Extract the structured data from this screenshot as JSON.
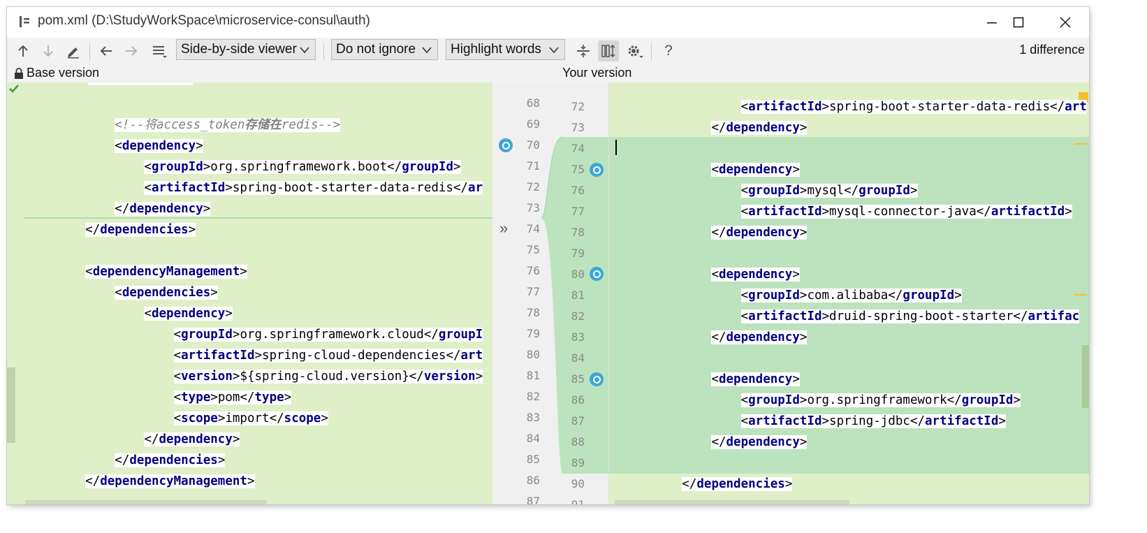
{
  "window": {
    "title": "pom.xml (D:\\StudyWorkSpace\\microservice-consul\\auth)"
  },
  "toolbar": {
    "viewer_mode": "Side-by-side viewer",
    "ignore_mode": "Do not ignore",
    "highlight_mode": "Highlight words",
    "help_label": "?",
    "diff_count": "1 difference"
  },
  "panels": {
    "base_label": "Base version",
    "yours_label": "Your version"
  },
  "colors": {
    "base_bg": "#dff0c8",
    "inserted_bg": "#bce3bd",
    "tag": "#000080",
    "comment": "#808080"
  },
  "left_lines": [
    {
      "num": "68",
      "text": ""
    },
    {
      "num": "69",
      "indent": 4,
      "parts": [
        [
          "cmt",
          "<!--将access_token"
        ],
        [
          "cmtb",
          "存储在"
        ],
        [
          "cmt",
          "redis-->"
        ]
      ]
    },
    {
      "num": "70",
      "indent": 4,
      "parts": [
        [
          "br",
          "<"
        ],
        [
          "tag",
          "dependency"
        ],
        [
          "br",
          ">"
        ]
      ]
    },
    {
      "num": "71",
      "indent": 6,
      "parts": [
        [
          "br",
          "<"
        ],
        [
          "tag",
          "groupId"
        ],
        [
          "br",
          ">"
        ],
        [
          "txt",
          "org.springframework.boot"
        ],
        [
          "br",
          "</"
        ],
        [
          "tag",
          "groupId"
        ],
        [
          "br",
          ">"
        ]
      ]
    },
    {
      "num": "72",
      "indent": 6,
      "parts": [
        [
          "br",
          "<"
        ],
        [
          "tag",
          "artifactId"
        ],
        [
          "br",
          ">"
        ],
        [
          "txt",
          "spring-boot-starter-data-redis"
        ],
        [
          "br",
          "</"
        ],
        [
          "tag",
          "ar"
        ]
      ]
    },
    {
      "num": "73",
      "indent": 4,
      "parts": [
        [
          "br",
          "</"
        ],
        [
          "tag",
          "dependency"
        ],
        [
          "br",
          ">"
        ]
      ]
    },
    {
      "num": "74",
      "indent": 2,
      "parts": [
        [
          "br",
          "</"
        ],
        [
          "tag",
          "dependencies"
        ],
        [
          "br",
          ">"
        ]
      ]
    },
    {
      "num": "75",
      "text": ""
    },
    {
      "num": "76",
      "indent": 2,
      "parts": [
        [
          "br",
          "<"
        ],
        [
          "tag",
          "dependencyManagement"
        ],
        [
          "br",
          ">"
        ]
      ]
    },
    {
      "num": "77",
      "indent": 4,
      "parts": [
        [
          "br",
          "<"
        ],
        [
          "tag",
          "dependencies"
        ],
        [
          "br",
          ">"
        ]
      ]
    },
    {
      "num": "78",
      "indent": 6,
      "parts": [
        [
          "br",
          "<"
        ],
        [
          "tag",
          "dependency"
        ],
        [
          "br",
          ">"
        ]
      ]
    },
    {
      "num": "79",
      "indent": 8,
      "parts": [
        [
          "br",
          "<"
        ],
        [
          "tag",
          "groupId"
        ],
        [
          "br",
          ">"
        ],
        [
          "txt",
          "org.springframework.cloud"
        ],
        [
          "br",
          "</"
        ],
        [
          "tag",
          "groupI"
        ]
      ]
    },
    {
      "num": "80",
      "indent": 8,
      "parts": [
        [
          "br",
          "<"
        ],
        [
          "tag",
          "artifactId"
        ],
        [
          "br",
          ">"
        ],
        [
          "txt",
          "spring-cloud-dependencies"
        ],
        [
          "br",
          "</"
        ],
        [
          "tag",
          "art"
        ]
      ]
    },
    {
      "num": "81",
      "indent": 8,
      "parts": [
        [
          "br",
          "<"
        ],
        [
          "tag",
          "version"
        ],
        [
          "br",
          ">"
        ],
        [
          "txt",
          "${spring-cloud.version}"
        ],
        [
          "br",
          "</"
        ],
        [
          "tag",
          "version"
        ],
        [
          "br",
          ">"
        ]
      ]
    },
    {
      "num": "82",
      "indent": 8,
      "parts": [
        [
          "br",
          "<"
        ],
        [
          "tag",
          "type"
        ],
        [
          "br",
          ">"
        ],
        [
          "txt",
          "pom"
        ],
        [
          "br",
          "</"
        ],
        [
          "tag",
          "type"
        ],
        [
          "br",
          ">"
        ]
      ]
    },
    {
      "num": "83",
      "indent": 8,
      "parts": [
        [
          "br",
          "<"
        ],
        [
          "tag",
          "scope"
        ],
        [
          "br",
          ">"
        ],
        [
          "txt",
          "import"
        ],
        [
          "br",
          "</"
        ],
        [
          "tag",
          "scope"
        ],
        [
          "br",
          ">"
        ]
      ]
    },
    {
      "num": "84",
      "indent": 6,
      "parts": [
        [
          "br",
          "</"
        ],
        [
          "tag",
          "dependency"
        ],
        [
          "br",
          ">"
        ]
      ]
    },
    {
      "num": "85",
      "indent": 4,
      "parts": [
        [
          "br",
          "</"
        ],
        [
          "tag",
          "dependencies"
        ],
        [
          "br",
          ">"
        ]
      ]
    },
    {
      "num": "86",
      "indent": 2,
      "parts": [
        [
          "br",
          "</"
        ],
        [
          "tag",
          "dependencyManagement"
        ],
        [
          "br",
          ">"
        ]
      ]
    },
    {
      "num": "87",
      "text": ""
    }
  ],
  "right_lines": [
    {
      "num": "72",
      "indent": 8,
      "parts": [
        [
          "br",
          "<"
        ],
        [
          "tag",
          "artifactId"
        ],
        [
          "br",
          ">"
        ],
        [
          "txt",
          "spring-boot-starter-data-redis"
        ],
        [
          "br",
          "</"
        ],
        [
          "tag",
          "art"
        ]
      ]
    },
    {
      "num": "73",
      "indent": 6,
      "parts": [
        [
          "br",
          "</"
        ],
        [
          "tag",
          "dependency"
        ],
        [
          "br",
          ">"
        ]
      ]
    },
    {
      "num": "74",
      "text": "",
      "inserted": true
    },
    {
      "num": "75",
      "indent": 6,
      "inserted": true,
      "parts": [
        [
          "br",
          "<"
        ],
        [
          "tag",
          "dependency"
        ],
        [
          "br",
          ">"
        ]
      ]
    },
    {
      "num": "76",
      "indent": 8,
      "inserted": true,
      "parts": [
        [
          "br",
          "<"
        ],
        [
          "tag",
          "groupId"
        ],
        [
          "br",
          ">"
        ],
        [
          "txt",
          "mysql"
        ],
        [
          "br",
          "</"
        ],
        [
          "tag",
          "groupId"
        ],
        [
          "br",
          ">"
        ]
      ]
    },
    {
      "num": "77",
      "indent": 8,
      "inserted": true,
      "parts": [
        [
          "br",
          "<"
        ],
        [
          "tag",
          "artifactId"
        ],
        [
          "br",
          ">"
        ],
        [
          "txt",
          "mysql-connector-java"
        ],
        [
          "br",
          "</"
        ],
        [
          "tag",
          "artifactId"
        ],
        [
          "br",
          ">"
        ]
      ]
    },
    {
      "num": "78",
      "indent": 6,
      "inserted": true,
      "parts": [
        [
          "br",
          "</"
        ],
        [
          "tag",
          "dependency"
        ],
        [
          "br",
          ">"
        ]
      ]
    },
    {
      "num": "79",
      "text": "",
      "inserted": true
    },
    {
      "num": "80",
      "indent": 6,
      "inserted": true,
      "parts": [
        [
          "br",
          "<"
        ],
        [
          "tag",
          "dependency"
        ],
        [
          "br",
          ">"
        ]
      ]
    },
    {
      "num": "81",
      "indent": 8,
      "inserted": true,
      "parts": [
        [
          "br",
          "<"
        ],
        [
          "tag",
          "groupId"
        ],
        [
          "br",
          ">"
        ],
        [
          "txt",
          "com.alibaba"
        ],
        [
          "br",
          "</"
        ],
        [
          "tag",
          "groupId"
        ],
        [
          "br",
          ">"
        ]
      ]
    },
    {
      "num": "82",
      "indent": 8,
      "inserted": true,
      "parts": [
        [
          "br",
          "<"
        ],
        [
          "tag",
          "artifactId"
        ],
        [
          "br",
          ">"
        ],
        [
          "txt",
          "druid-spring-boot-starter"
        ],
        [
          "br",
          "</"
        ],
        [
          "tag",
          "artifac"
        ]
      ]
    },
    {
      "num": "83",
      "indent": 6,
      "inserted": true,
      "parts": [
        [
          "br",
          "</"
        ],
        [
          "tag",
          "dependency"
        ],
        [
          "br",
          ">"
        ]
      ]
    },
    {
      "num": "84",
      "text": "",
      "inserted": true
    },
    {
      "num": "85",
      "indent": 6,
      "inserted": true,
      "parts": [
        [
          "br",
          "<"
        ],
        [
          "tag",
          "dependency"
        ],
        [
          "br",
          ">"
        ]
      ]
    },
    {
      "num": "86",
      "indent": 8,
      "inserted": true,
      "parts": [
        [
          "br",
          "<"
        ],
        [
          "tag",
          "groupId"
        ],
        [
          "br",
          ">"
        ],
        [
          "txt",
          "org.springframework"
        ],
        [
          "br",
          "</"
        ],
        [
          "tag",
          "groupId"
        ],
        [
          "br",
          ">"
        ]
      ]
    },
    {
      "num": "87",
      "indent": 8,
      "inserted": true,
      "parts": [
        [
          "br",
          "<"
        ],
        [
          "tag",
          "artifactId"
        ],
        [
          "br",
          ">"
        ],
        [
          "txt",
          "spring-jdbc"
        ],
        [
          "br",
          "</"
        ],
        [
          "tag",
          "artifactId"
        ],
        [
          "br",
          ">"
        ]
      ]
    },
    {
      "num": "88",
      "indent": 6,
      "inserted": true,
      "parts": [
        [
          "br",
          "</"
        ],
        [
          "tag",
          "dependency"
        ],
        [
          "br",
          ">"
        ]
      ]
    },
    {
      "num": "89",
      "text": "",
      "inserted": true
    },
    {
      "num": "90",
      "indent": 4,
      "parts": [
        [
          "br",
          "</"
        ],
        [
          "tag",
          "dependencies"
        ],
        [
          "br",
          ">"
        ]
      ]
    },
    {
      "num": "91",
      "text": ""
    }
  ]
}
